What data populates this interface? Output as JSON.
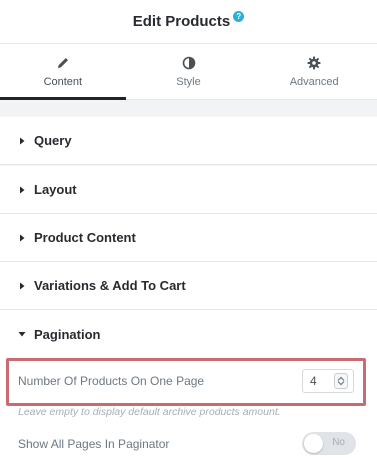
{
  "header": {
    "title": "Edit Products",
    "help_icon": "?"
  },
  "tabs": [
    {
      "label": "Content",
      "icon": "pencil-icon",
      "active": true
    },
    {
      "label": "Style",
      "icon": "half-circle-icon",
      "active": false
    },
    {
      "label": "Advanced",
      "icon": "gear-icon",
      "active": false
    }
  ],
  "sections": [
    {
      "label": "Query",
      "expanded": false
    },
    {
      "label": "Layout",
      "expanded": false
    },
    {
      "label": "Product Content",
      "expanded": false
    },
    {
      "label": "Variations & Add To Cart",
      "expanded": false
    },
    {
      "label": "Pagination",
      "expanded": true
    }
  ],
  "pagination": {
    "products_per_page_label": "Number Of Products On One Page",
    "products_per_page_value": "4",
    "products_per_page_description": "Leave empty to display default archive products amount.",
    "show_all_pages_label": "Show All Pages In Paginator",
    "show_all_pages_toggle": "No"
  },
  "colors": {
    "highlight": "#c86b72",
    "accent": "#2ab1d9"
  }
}
